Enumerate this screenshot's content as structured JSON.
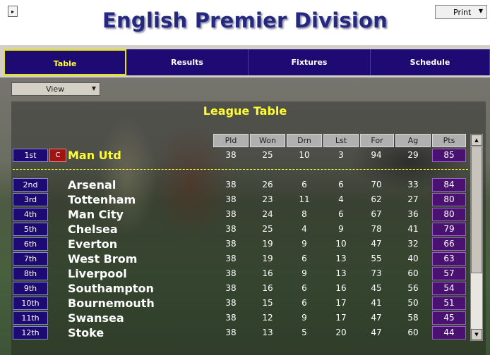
{
  "window": {
    "title": "English Premier Division",
    "expand_glyph": "▸",
    "print_label": "Print",
    "dropdown_glyph": "▼"
  },
  "tabs": [
    {
      "label": "Table",
      "active": true
    },
    {
      "label": "Results",
      "active": false
    },
    {
      "label": "Fixtures",
      "active": false
    },
    {
      "label": "Schedule",
      "active": false
    }
  ],
  "view_select": {
    "label": "View"
  },
  "league_table": {
    "title": "League Table",
    "columns": [
      "Pld",
      "Won",
      "Drn",
      "Lst",
      "For",
      "Ag",
      "Pts"
    ],
    "champion_badge": "C",
    "rows": [
      {
        "pos": "1st",
        "team": "Man Utd",
        "pld": "38",
        "won": "25",
        "drn": "10",
        "lst": "3",
        "for": "94",
        "ag": "29",
        "pts": "85"
      },
      {
        "pos": "2nd",
        "team": "Arsenal",
        "pld": "38",
        "won": "26",
        "drn": "6",
        "lst": "6",
        "for": "70",
        "ag": "33",
        "pts": "84"
      },
      {
        "pos": "3rd",
        "team": "Tottenham",
        "pld": "38",
        "won": "23",
        "drn": "11",
        "lst": "4",
        "for": "62",
        "ag": "27",
        "pts": "80"
      },
      {
        "pos": "4th",
        "team": "Man City",
        "pld": "38",
        "won": "24",
        "drn": "8",
        "lst": "6",
        "for": "67",
        "ag": "36",
        "pts": "80"
      },
      {
        "pos": "5th",
        "team": "Chelsea",
        "pld": "38",
        "won": "25",
        "drn": "4",
        "lst": "9",
        "for": "78",
        "ag": "41",
        "pts": "79"
      },
      {
        "pos": "6th",
        "team": "Everton",
        "pld": "38",
        "won": "19",
        "drn": "9",
        "lst": "10",
        "for": "47",
        "ag": "32",
        "pts": "66"
      },
      {
        "pos": "7th",
        "team": "West Brom",
        "pld": "38",
        "won": "19",
        "drn": "6",
        "lst": "13",
        "for": "55",
        "ag": "40",
        "pts": "63"
      },
      {
        "pos": "8th",
        "team": "Liverpool",
        "pld": "38",
        "won": "16",
        "drn": "9",
        "lst": "13",
        "for": "73",
        "ag": "60",
        "pts": "57"
      },
      {
        "pos": "9th",
        "team": "Southampton",
        "pld": "38",
        "won": "16",
        "drn": "6",
        "lst": "16",
        "for": "45",
        "ag": "56",
        "pts": "54"
      },
      {
        "pos": "10th",
        "team": "Bournemouth",
        "pld": "38",
        "won": "15",
        "drn": "6",
        "lst": "17",
        "for": "41",
        "ag": "50",
        "pts": "51"
      },
      {
        "pos": "11th",
        "team": "Swansea",
        "pld": "38",
        "won": "12",
        "drn": "9",
        "lst": "17",
        "for": "47",
        "ag": "58",
        "pts": "45"
      },
      {
        "pos": "12th",
        "team": "Stoke",
        "pld": "38",
        "won": "13",
        "drn": "5",
        "lst": "20",
        "for": "47",
        "ag": "60",
        "pts": "44"
      }
    ]
  },
  "scrollbar": {
    "up_glyph": "▲",
    "down_glyph": "▼"
  },
  "colors": {
    "title": "#24287e",
    "tab_bg": "#1e0a73",
    "active_tab_border": "#e6e600",
    "champion_text": "#ffff33",
    "champion_badge": "#a01414",
    "points_bg": "#4a1270"
  }
}
